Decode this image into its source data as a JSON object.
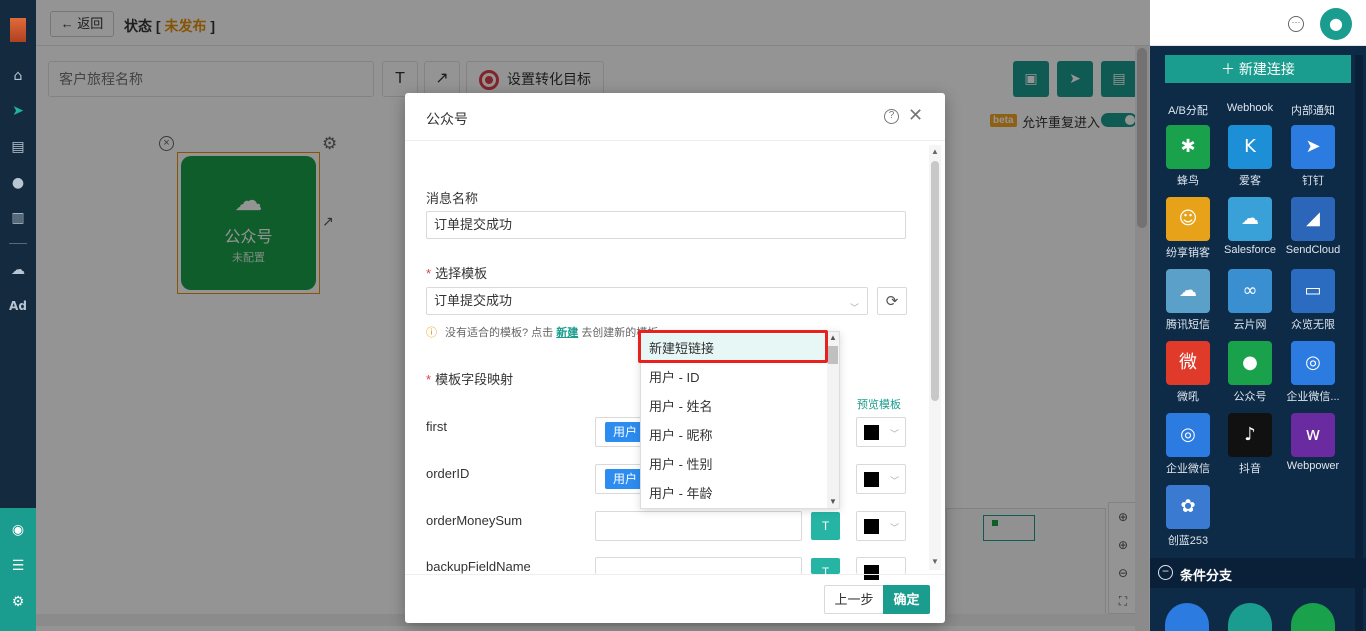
{
  "topbar": {
    "back_label": "← 返回",
    "status_prefix": "状态 [ ",
    "status_value": "未发布",
    "status_suffix": " ]"
  },
  "leftnav": {
    "icons": [
      "home-icon",
      "send-icon",
      "layout-icon",
      "user-icon",
      "chart-icon",
      "wechat-icon",
      "ad-icon"
    ],
    "ad_label": "Ad"
  },
  "toolbar": {
    "journey_placeholder": "客户旅程名称",
    "text_tool": "T",
    "arrow_tool": "↗",
    "goal_label": "设置转化目标"
  },
  "canvas": {
    "beta": "beta",
    "allow_reentry": "允许重复进入",
    "node_title": "公众号",
    "node_sub": "未配置"
  },
  "rpanel": {
    "new_conn": "＋ 新建连接",
    "row0": [
      "A/B分配",
      "Webhook",
      "内部通知"
    ],
    "tiles": [
      {
        "label": "蜂鸟",
        "color": "#1aa14b",
        "glyph": "✱"
      },
      {
        "label": "爱客",
        "color": "#1d8fd6",
        "glyph": "K"
      },
      {
        "label": "钉钉",
        "color": "#2b7be0",
        "glyph": "➤"
      },
      {
        "label": "纷享销客",
        "color": "#e8a21a",
        "glyph": "☺"
      },
      {
        "label": "Salesforce",
        "color": "#3aa0d8",
        "glyph": "☁"
      },
      {
        "label": "SendCloud",
        "color": "#2b66b8",
        "glyph": "◢"
      },
      {
        "label": "腾讯短信",
        "color": "#5aa0c8",
        "glyph": "☁"
      },
      {
        "label": "云片网",
        "color": "#3a8fd0",
        "glyph": "∞"
      },
      {
        "label": "众览无限",
        "color": "#2b6cc0",
        "glyph": "▭"
      },
      {
        "label": "微吼",
        "color": "#e03a2a",
        "glyph": "微"
      },
      {
        "label": "公众号",
        "color": "#1aa14b",
        "glyph": "●"
      },
      {
        "label": "企业微信...",
        "color": "#2b7be0",
        "glyph": "◎"
      },
      {
        "label": "企业微信",
        "color": "#2b7be0",
        "glyph": "◎"
      },
      {
        "label": "抖音",
        "color": "#111111",
        "glyph": "♪"
      },
      {
        "label": "Webpower",
        "color": "#6a2aa0",
        "glyph": "w"
      },
      {
        "label": "创蓝253",
        "color": "#3a7ad0",
        "glyph": "✿"
      }
    ],
    "cond_label": "条件分支"
  },
  "modal": {
    "title": "公众号",
    "msg_name_label": "消息名称",
    "msg_name_value": "订单提交成功",
    "template_label": "选择模板",
    "template_value": "订单提交成功",
    "hint_prefix": "没有适合的模板? 点击",
    "hint_link": "新建",
    "hint_suffix": "去创建新的模板",
    "mapping_label": "模板字段映射",
    "preview_link": "预览模板",
    "fields": [
      {
        "name": "first",
        "tag": "用户"
      },
      {
        "name": "orderID",
        "tag": "用户"
      },
      {
        "name": "orderMoneySum",
        "tag": ""
      },
      {
        "name": "backupFieldName",
        "tag": ""
      }
    ],
    "prev_label": "上一步",
    "ok_label": "确定"
  },
  "dropdown": {
    "options": [
      "新建短链接",
      "用户 - ID",
      "用户 - 姓名",
      "用户 - 昵称",
      "用户 - 性别",
      "用户 - 年龄"
    ]
  },
  "colors": {
    "primary": "#1a9c8e",
    "nav_bg": "#142b3f",
    "panel_bg": "#0d2a47",
    "highlight": "#e8201e",
    "status": "#e8910a"
  }
}
